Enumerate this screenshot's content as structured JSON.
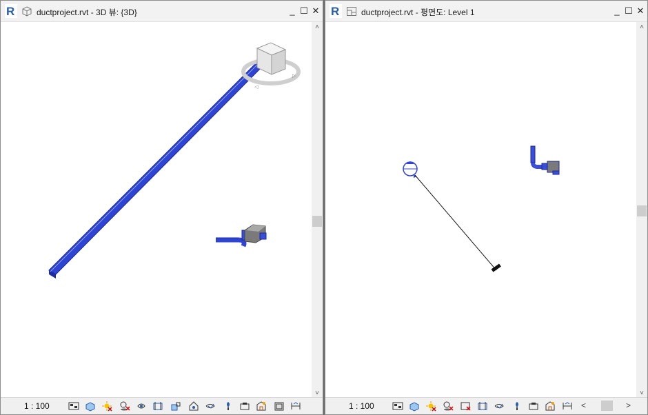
{
  "left_window": {
    "title": "ductproject.rvt - 3D 뷰: {3D}",
    "scale": "1 : 100",
    "controls": {
      "minimize": "_",
      "maximize": "☐",
      "close": "✕"
    }
  },
  "right_window": {
    "title": "ductproject.rvt - 평면도: Level 1",
    "scale": "1 : 100",
    "controls": {
      "minimize": "_",
      "maximize": "☐",
      "close": "✕"
    }
  },
  "scroll": {
    "up": "˄",
    "down": "˅",
    "left": "<",
    "right": ">"
  },
  "colors": {
    "accent": "#1f58c4",
    "duct": "#3a4fd8",
    "duct_dark": "#1c2ca8",
    "revit_logo": "#2a5fa8"
  },
  "view_control_icons": [
    "detail-level-icon",
    "visual-style-icon",
    "sun-path-icon",
    "shadows-icon",
    "crop-view-icon",
    "show-crop-region-icon",
    "unlock-3d-view-icon",
    "temporary-hide-icon",
    "reveal-hidden-icon",
    "temporary-view-properties-icon",
    "analytical-model-icon",
    "highlight-displacement-icon",
    "show-constraints-icon"
  ]
}
